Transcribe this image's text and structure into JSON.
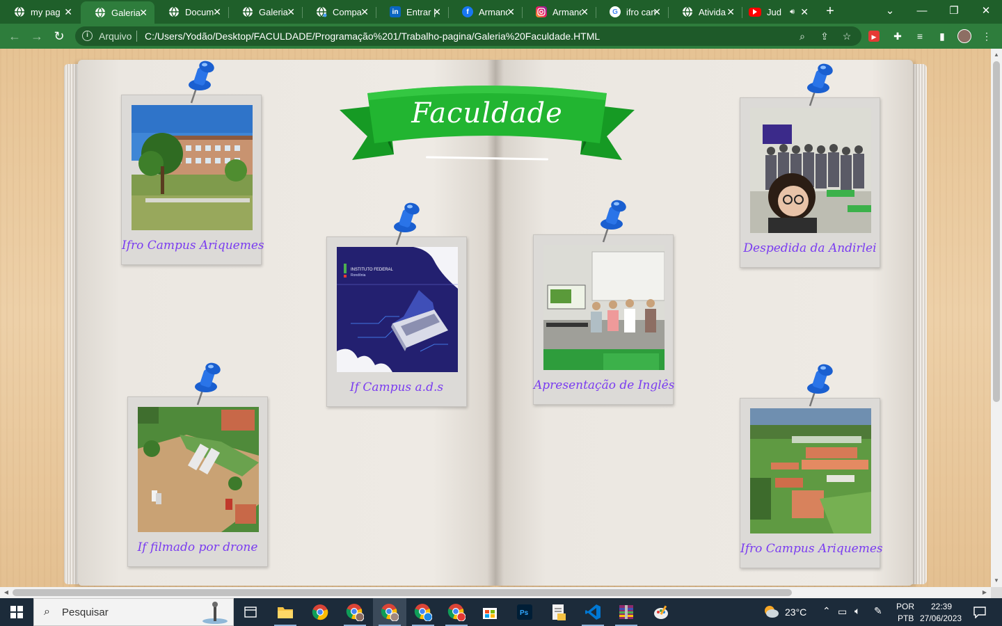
{
  "browser": {
    "tabs": [
      {
        "title": "my pag",
        "icon": "globe-icon",
        "active": false
      },
      {
        "title": "Galeria",
        "icon": "globe-icon",
        "active": true
      },
      {
        "title": "Docume",
        "icon": "globe-icon",
        "active": false
      },
      {
        "title": "Galeria",
        "icon": "globe-icon",
        "active": false
      },
      {
        "title": "Compar",
        "icon": "globe-icon",
        "active": false
      },
      {
        "title": "Entrar |",
        "icon": "linkedin-icon",
        "active": false
      },
      {
        "title": "Armand",
        "icon": "facebook-icon",
        "active": false
      },
      {
        "title": "Armand",
        "icon": "instagram-icon",
        "active": false
      },
      {
        "title": "ifro can",
        "icon": "google-icon",
        "active": false
      },
      {
        "title": "Ativida",
        "icon": "globe-icon",
        "active": false
      },
      {
        "title": "Jud",
        "icon": "youtube-icon",
        "active": false
      }
    ],
    "new_tab_label": "+",
    "address": {
      "scheme_label": "Arquivo",
      "url": "C:/Users/Yodão/Desktop/FACULDADE/Programação%201/Trabalho-pagina/Galeria%20Faculdade.HTML"
    }
  },
  "page": {
    "banner_title": "Faculdade",
    "photos": [
      {
        "caption": "Ifro Campus Ariquemes",
        "subject": "campus-building"
      },
      {
        "caption": "If Campus a.d.s",
        "subject": "ifro-ads-laptop-graphic"
      },
      {
        "caption": "Apresentação de Inglês",
        "subject": "classroom-presentation"
      },
      {
        "caption": "Despedida da Andirlei",
        "subject": "class-group-photo"
      },
      {
        "caption": "If filmado por drone",
        "subject": "aerial-parking"
      },
      {
        "caption": "Ifro Campus Ariquemes",
        "subject": "aerial-campus"
      }
    ],
    "logo_text": {
      "line1": "INSTITUTO FEDERAL",
      "line2": "Rondônia"
    }
  },
  "taskbar": {
    "search_placeholder": "Pesquisar",
    "weather": "23°C",
    "language": "POR",
    "keyboard": "PTB",
    "time": "22:39",
    "date": "27/06/2023"
  },
  "colors": {
    "chrome_green": "#2e7d3c",
    "ribbon_green": "#1fae2e",
    "caption_purple": "#7a3cf0",
    "pin_blue": "#1a5fd0"
  }
}
